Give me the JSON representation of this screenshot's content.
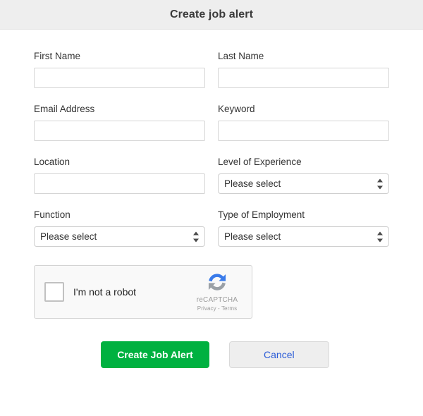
{
  "header": {
    "title": "Create job alert"
  },
  "form": {
    "fields": [
      {
        "label": "First Name",
        "type": "text",
        "value": "",
        "placeholder": ""
      },
      {
        "label": "Last Name",
        "type": "text",
        "value": "",
        "placeholder": ""
      },
      {
        "label": "Email Address",
        "type": "text",
        "value": "",
        "placeholder": ""
      },
      {
        "label": "Keyword",
        "type": "text",
        "value": "",
        "placeholder": ""
      },
      {
        "label": "Location",
        "type": "text",
        "value": "",
        "placeholder": ""
      },
      {
        "label": "Level of Experience",
        "type": "select",
        "value": "Please select"
      },
      {
        "label": "Function",
        "type": "select",
        "value": "Please select"
      },
      {
        "label": "Type of Employment",
        "type": "select",
        "value": "Please select"
      }
    ]
  },
  "captcha": {
    "label": "I'm not a robot",
    "brand": "reCAPTCHA",
    "legal": "Privacy - Terms",
    "checked": false
  },
  "actions": {
    "submit_label": "Create Job Alert",
    "cancel_label": "Cancel"
  },
  "colors": {
    "header_bg": "#eeeeee",
    "primary": "#00b140",
    "secondary_bg": "#eeeeee",
    "link": "#2a5bd7",
    "captcha_blue": "#3a7bea",
    "captcha_gray": "#9aa0a6"
  }
}
